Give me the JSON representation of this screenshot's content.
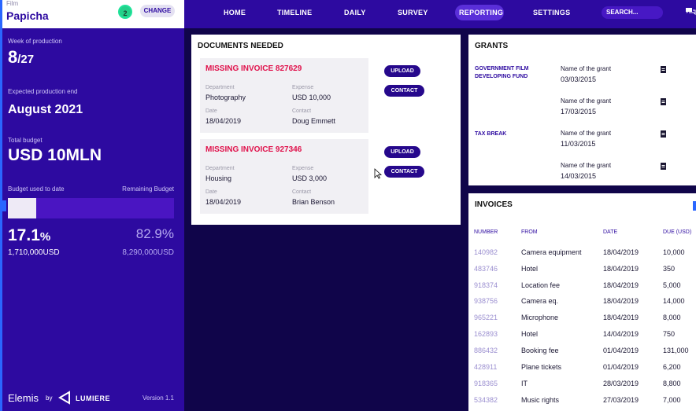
{
  "sidebar": {
    "film_label": "Film",
    "film_name": "Papicha",
    "notifications_count": "2",
    "change_label": "CHANGE",
    "week_label": "Week of production",
    "week_current": "8",
    "week_total": "/27",
    "production_end_label": "Expected production end",
    "production_end": "August 2021",
    "total_budget_label": "Total budget",
    "total_budget": "USD 10MLN",
    "budget_used_label": "Budget used to date",
    "remaining_label": "Remaining Budget",
    "used_fraction": 0.171,
    "used_pct": "17.1",
    "used_pct_symbol": "%",
    "used_amount": "1,710,000USD",
    "remaining_pct": "82.9%",
    "remaining_amount": "8,290,000USD",
    "brand": "Elemis",
    "by": "by",
    "partner": "LUMIERE",
    "version": "Version 1.1"
  },
  "nav": {
    "items": [
      "HOME",
      "TIMELINE",
      "DAILY",
      "SURVEY",
      "REPORTING",
      "SETTINGS"
    ],
    "active": "REPORTING",
    "search_placeholder": "SEARCH..."
  },
  "documents": {
    "title": "DOCUMENTS NEEDED",
    "items": [
      {
        "title": "MISSING INVOICE 827629",
        "department_label": "Department",
        "department": "Photography",
        "expense_label": "Expense",
        "expense": "USD 10,000",
        "date_label": "Date",
        "date": "18/04/2019",
        "contact_label": "Contact",
        "contact": "Doug Emmett",
        "upload_label": "UPLOAD",
        "contact_btn_label": "CONTACT"
      },
      {
        "title": "MISSING INVOICE 927346",
        "department_label": "Department",
        "department": "Housing",
        "expense_label": "Expense",
        "expense": "USD 3,000",
        "date_label": "Date",
        "date": "18/04/2019",
        "contact_label": "Contact",
        "contact": "Brian Benson",
        "upload_label": "UPLOAD",
        "contact_btn_label": "CONTACT"
      }
    ]
  },
  "grants": {
    "title": "GRANTS",
    "orgs": [
      "GOVERNMENT FILM DEVELOPING FUND",
      "TAX BREAK"
    ],
    "items": [
      {
        "name": "Name of the grant",
        "date": "03/03/2015"
      },
      {
        "name": "Name of the grant",
        "date": "17/03/2015"
      },
      {
        "name": "Name of the grant",
        "date": "11/03/2015"
      },
      {
        "name": "Name of the grant",
        "date": "14/03/2015"
      }
    ]
  },
  "invoices": {
    "title": "INVOICES",
    "headers": [
      "NUMBER",
      "FROM",
      "DATE",
      "DUE (USD)"
    ],
    "rows": [
      {
        "number": "140982",
        "from": "Camera equipment",
        "date": "18/04/2019",
        "due": "10,000"
      },
      {
        "number": "483746",
        "from": "Hotel",
        "date": "18/04/2019",
        "due": "350"
      },
      {
        "number": "918374",
        "from": "Location fee",
        "date": "18/04/2019",
        "due": "5,000"
      },
      {
        "number": "938756",
        "from": "Camera eq.",
        "date": "18/04/2019",
        "due": "14,000"
      },
      {
        "number": "965221",
        "from": "Microphone",
        "date": "18/04/2019",
        "due": "8,000"
      },
      {
        "number": "162893",
        "from": "Hotel",
        "date": "14/04/2019",
        "due": "750"
      },
      {
        "number": "886432",
        "from": "Booking fee",
        "date": "01/04/2019",
        "due": "131,000"
      },
      {
        "number": "428911",
        "from": "Plane tickets",
        "date": "01/04/2019",
        "due": "6,200"
      },
      {
        "number": "918365",
        "from": "IT",
        "date": "28/03/2019",
        "due": "8,800"
      },
      {
        "number": "534382",
        "from": "Music rights",
        "date": "27/03/2019",
        "due": "7,000"
      }
    ]
  }
}
